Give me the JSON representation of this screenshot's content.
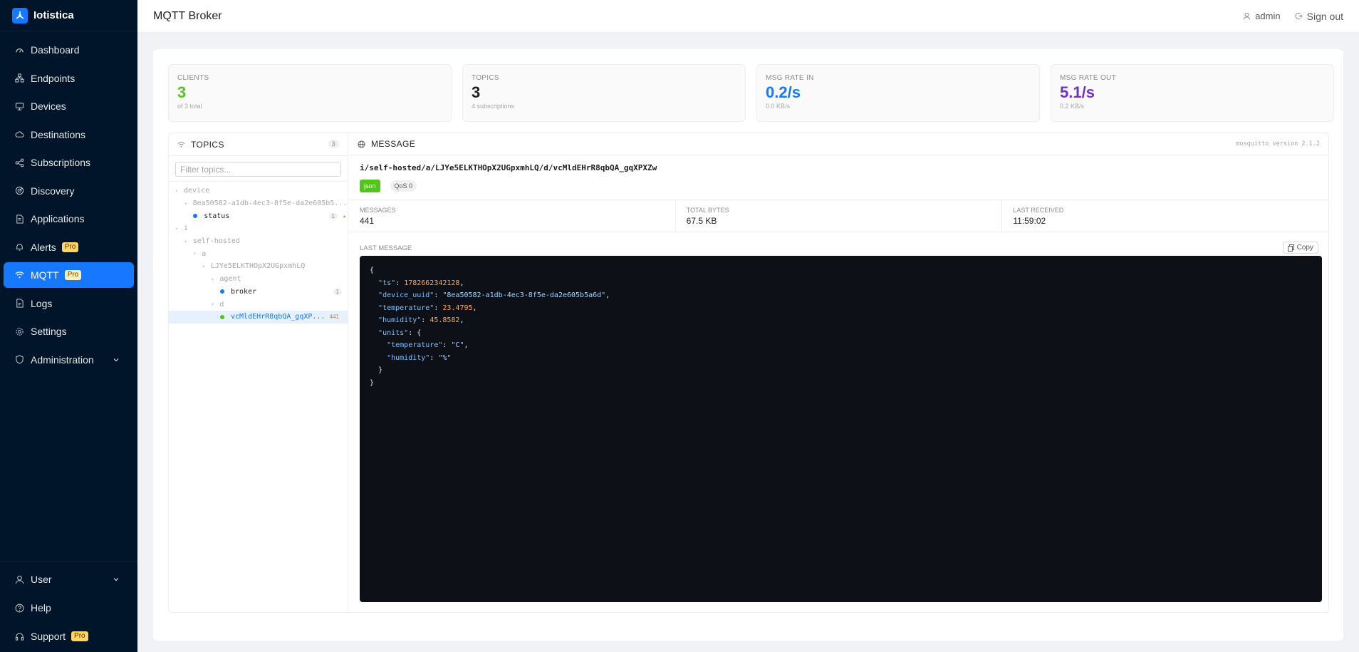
{
  "app": {
    "name": "Iotistica"
  },
  "sidebar": {
    "items": [
      {
        "label": "Dashboard",
        "icon": "dashboard-icon"
      },
      {
        "label": "Endpoints",
        "icon": "endpoints-icon"
      },
      {
        "label": "Devices",
        "icon": "devices-icon"
      },
      {
        "label": "Destinations",
        "icon": "cloud-icon"
      },
      {
        "label": "Subscriptions",
        "icon": "share-icon"
      },
      {
        "label": "Discovery",
        "icon": "radar-icon"
      },
      {
        "label": "Applications",
        "icon": "file-icon"
      },
      {
        "label": "Alerts",
        "icon": "alert-icon",
        "badge": "Pro"
      },
      {
        "label": "MQTT",
        "icon": "wifi-icon",
        "badge": "Pro",
        "active": true
      },
      {
        "label": "Logs",
        "icon": "log-icon"
      },
      {
        "label": "Settings",
        "icon": "gear-icon"
      },
      {
        "label": "Administration",
        "icon": "shield-icon"
      }
    ],
    "bottom": [
      {
        "label": "User",
        "icon": "user-icon"
      },
      {
        "label": "Help",
        "icon": "help-icon"
      },
      {
        "label": "Support",
        "icon": "headset-icon",
        "badge": "Pro"
      }
    ]
  },
  "header": {
    "title": "MQTT Broker",
    "user": "admin",
    "signout": "Sign out"
  },
  "stats": [
    {
      "label": "CLIENTS",
      "value": "3",
      "sub": "of 3 total",
      "color": "#52c41a"
    },
    {
      "label": "TOPICS",
      "value": "3",
      "sub": "4 subscriptions",
      "color": "#1f1f1f"
    },
    {
      "label": "MSG RATE IN",
      "value": "0.2/s",
      "sub": "0.0 KB/s",
      "color": "#1677ff"
    },
    {
      "label": "MSG RATE OUT",
      "value": "5.1/s",
      "sub": "0.2 KB/s",
      "color": "#722ed1"
    }
  ],
  "topics_panel": {
    "title": "TOPICS",
    "count": "3",
    "filter_placeholder": "Filter topics...",
    "tree": [
      {
        "label": "device",
        "depth": 0,
        "type": "folder"
      },
      {
        "label": "8ea50582-a1db-4ec3-8f5e-da2e605b5...",
        "depth": 1,
        "type": "folder"
      },
      {
        "label": "status",
        "depth": 2,
        "type": "leaf",
        "dot": "#1677ff",
        "badge": "1",
        "star": true
      },
      {
        "label": "i",
        "depth": 0,
        "type": "folder"
      },
      {
        "label": "self-hosted",
        "depth": 1,
        "type": "folder"
      },
      {
        "label": "a",
        "depth": 2,
        "type": "folder"
      },
      {
        "label": "LJYe5ELKTHOpX2UGpxmhLQ",
        "depth": 3,
        "type": "folder"
      },
      {
        "label": "agent",
        "depth": 4,
        "type": "folder"
      },
      {
        "label": "broker",
        "depth": 5,
        "type": "leaf",
        "dot": "#1677ff",
        "badge": "1"
      },
      {
        "label": "d",
        "depth": 4,
        "type": "folder"
      },
      {
        "label": "vcMldEHrR8qbQA_gqXP...",
        "depth": 5,
        "type": "leaf",
        "dot": "#52c41a",
        "badge": "441",
        "selected": true
      }
    ]
  },
  "message_panel": {
    "title": "MESSAGE",
    "version": "mosquitto version 2.1.2",
    "topic": "i/self-hosted/a/LJYe5ELKTHOpX2UGpxmhLQ/d/vcMldEHrR8qbQA_gqXPXZw",
    "format_tag": "json",
    "qos_tag": "QoS 0",
    "stats": [
      {
        "label": "MESSAGES",
        "value": "441"
      },
      {
        "label": "TOTAL BYTES",
        "value": "67.5 KB"
      },
      {
        "label": "LAST RECEIVED",
        "value": "11:59:02"
      }
    ],
    "last_message_label": "LAST MESSAGE",
    "copy_label": "Copy",
    "payload": {
      "ts": "1782662342128",
      "device_uuid": "8ea50582-a1db-4ec3-8f5e-da2e605b5a6d",
      "temperature": "23.4795",
      "humidity": "45.8582",
      "units_temperature": "C",
      "units_humidity": "%"
    }
  }
}
